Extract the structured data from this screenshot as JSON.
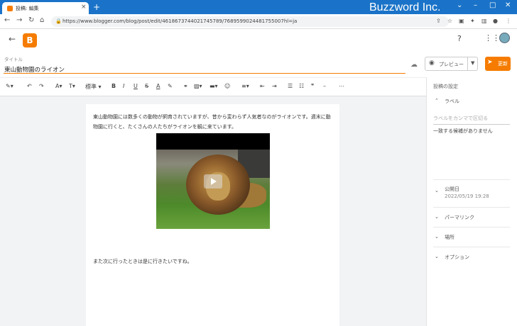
{
  "browser": {
    "tab_title": "投稿: 編集",
    "new_tab": "+",
    "brand": "Buzzword Inc.",
    "url": "https://www.blogger.com/blog/post/edit/4618673744021745789/7689599024481755007hl=ja"
  },
  "editor": {
    "title_label": "タイトル",
    "title": "東山動物園のライオン",
    "preview_label": "プレビュー",
    "update_label": "更新",
    "format_label": "標準",
    "body_p1": "東山動物園には数多くの動物が飼育されていますが、昔から変わらず人気者なのがライオンです。週末に動物園に行くと、たくさんの人たちがライオンを観に来ています。",
    "body_p2": "また次に行ったときは是に行きたいですね。"
  },
  "sidebar": {
    "heading": "投稿の設定",
    "labels_title": "ラベル",
    "labels_placeholder": "ラベルをカンマで区切る",
    "no_match": "一致する候補がありません",
    "publish_title": "公開日",
    "publish_date": "2022/05/19 19:28",
    "permalink_title": "パーマリンク",
    "location_title": "場所",
    "options_title": "オプション"
  },
  "colors": {
    "accent": "#f57c00",
    "tabbar": "#1a73c8"
  }
}
